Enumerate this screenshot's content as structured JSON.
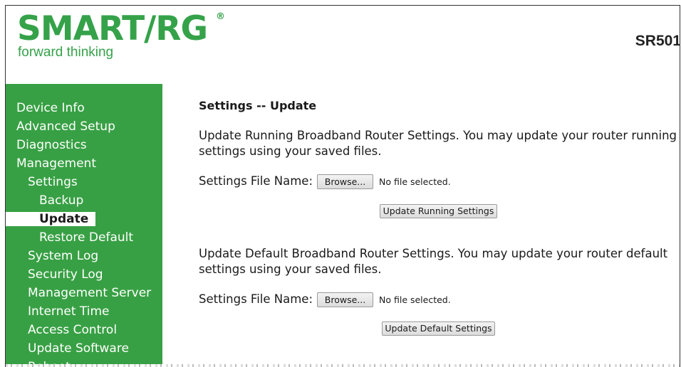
{
  "header": {
    "logo_text": "SMART/RG",
    "logo_reg": "®",
    "tagline": "forward thinking",
    "model": "SR501"
  },
  "sidebar": {
    "items": [
      {
        "label": "Device Info"
      },
      {
        "label": "Advanced Setup"
      },
      {
        "label": "Diagnostics"
      },
      {
        "label": "Management"
      },
      {
        "label": "Settings"
      },
      {
        "label": "Backup"
      },
      {
        "label": "Update",
        "active": true
      },
      {
        "label": "Restore Default"
      },
      {
        "label": "System Log"
      },
      {
        "label": "Security Log"
      },
      {
        "label": "Management Server"
      },
      {
        "label": "Internet Time"
      },
      {
        "label": "Access Control"
      },
      {
        "label": "Update Software"
      },
      {
        "label": "Reboot"
      }
    ]
  },
  "main": {
    "title": "Settings -- Update",
    "running": {
      "description": "Update Running Broadband Router Settings. You may update your router running settings using your saved files.",
      "file_label": "Settings File Name:",
      "browse_label": "Browse...",
      "file_status": "No file selected.",
      "button_label": "Update Running Settings"
    },
    "default": {
      "description": "Update Default Broadband Router Settings. You may update your router default settings using your saved files.",
      "file_label": "Settings File Name:",
      "browse_label": "Browse...",
      "file_status": "No file selected.",
      "button_label": "Update Default Settings"
    }
  },
  "colors": {
    "brand_green": "#38a044",
    "logo_green": "#35a24a"
  }
}
